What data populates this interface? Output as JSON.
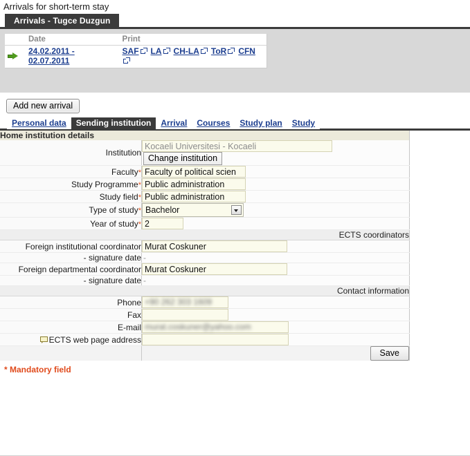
{
  "page": {
    "heading": "Arrivals for short-term stay",
    "mandatory_note": "* Mandatory field"
  },
  "arrivals_panel": {
    "tab_label": "Arrivals - Tugce Duzgun",
    "columns": [
      "Date",
      "Print"
    ],
    "rows": [
      {
        "arrow_icon": "green-arrow-icon",
        "date": "24.02.2011 - 02.07.2011",
        "print_links": [
          "SAF",
          "LA",
          "CH-LA",
          "ToR",
          "CFN"
        ]
      }
    ],
    "add_button": "Add new arrival"
  },
  "tabs": [
    {
      "label": "Personal data",
      "active": false
    },
    {
      "label": "Sending institution",
      "active": true
    },
    {
      "label": "Arrival",
      "active": false
    },
    {
      "label": "Courses",
      "active": false
    },
    {
      "label": "Study plan",
      "active": false
    },
    {
      "label": "Study",
      "active": false
    }
  ],
  "form": {
    "sections": {
      "home": "Home institution details",
      "coordinators": "ECTS coordinators",
      "contact": "Contact information"
    },
    "institution": {
      "label": "Institution",
      "value": "Kocaeli Universitesi - Kocaeli",
      "change_button": "Change institution"
    },
    "faculty": {
      "label": "Faculty",
      "value": "Faculty of political scien",
      "required": "*"
    },
    "study_programme": {
      "label": "Study Programme",
      "value": "Public administration",
      "required": "*"
    },
    "study_field": {
      "label": "Study field",
      "value": "Public administration",
      "required": "*"
    },
    "type_of_study": {
      "label": "Type of study",
      "value": "Bachelor",
      "required": "*"
    },
    "year_of_study": {
      "label": "Year of study",
      "value": "2",
      "required": "*"
    },
    "foreign_institutional_coordinator": {
      "label": "Foreign institutional coordinator",
      "value": "Murat Coskuner"
    },
    "institutional_signature_date": {
      "label": "- signature date",
      "value": "-"
    },
    "foreign_departmental_coordinator": {
      "label": "Foreign departmental coordinator",
      "value": "Murat Coskuner"
    },
    "departmental_signature_date": {
      "label": "- signature date",
      "value": "-"
    },
    "phone": {
      "label": "Phone",
      "value": "+90 262 303 1609"
    },
    "fax": {
      "label": "Fax",
      "value": ""
    },
    "email": {
      "label": "E-mail",
      "value": "murat.coskuner@yahoo.com"
    },
    "ects_web_page": {
      "label": "ECTS web page address",
      "value": "",
      "icon": "comment-icon"
    },
    "save_button": "Save"
  },
  "colors": {
    "tab_active_bg": "#3b3b3b",
    "link": "#1b3d8f",
    "field_bg": "#fbfbec",
    "section_home_bg": "#eceadb",
    "mandatory": "#e04a1b",
    "arrow_green": "#4f9b1d"
  }
}
